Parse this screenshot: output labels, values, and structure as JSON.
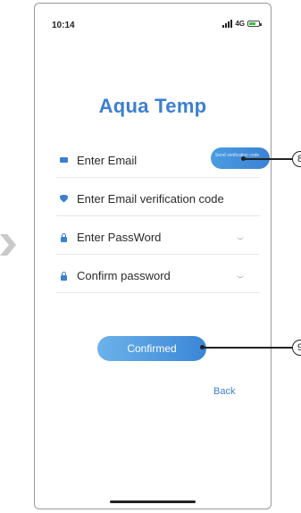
{
  "status_bar": {
    "time": "10:14",
    "network": "4G"
  },
  "app": {
    "title": "Aqua Temp"
  },
  "form": {
    "email_label": "Enter Email",
    "send_code_button": "Send verification code",
    "code_label": "Enter Email verification code",
    "password_label": "Enter PassWord",
    "confirm_password_label": "Confirm password"
  },
  "actions": {
    "confirm_label": "Confirmed",
    "back_label": "Back"
  },
  "callouts": {
    "send_code": "8",
    "confirm": "9"
  },
  "colors": {
    "accent": "#3b7fd0",
    "button": "#4a9ce0"
  }
}
